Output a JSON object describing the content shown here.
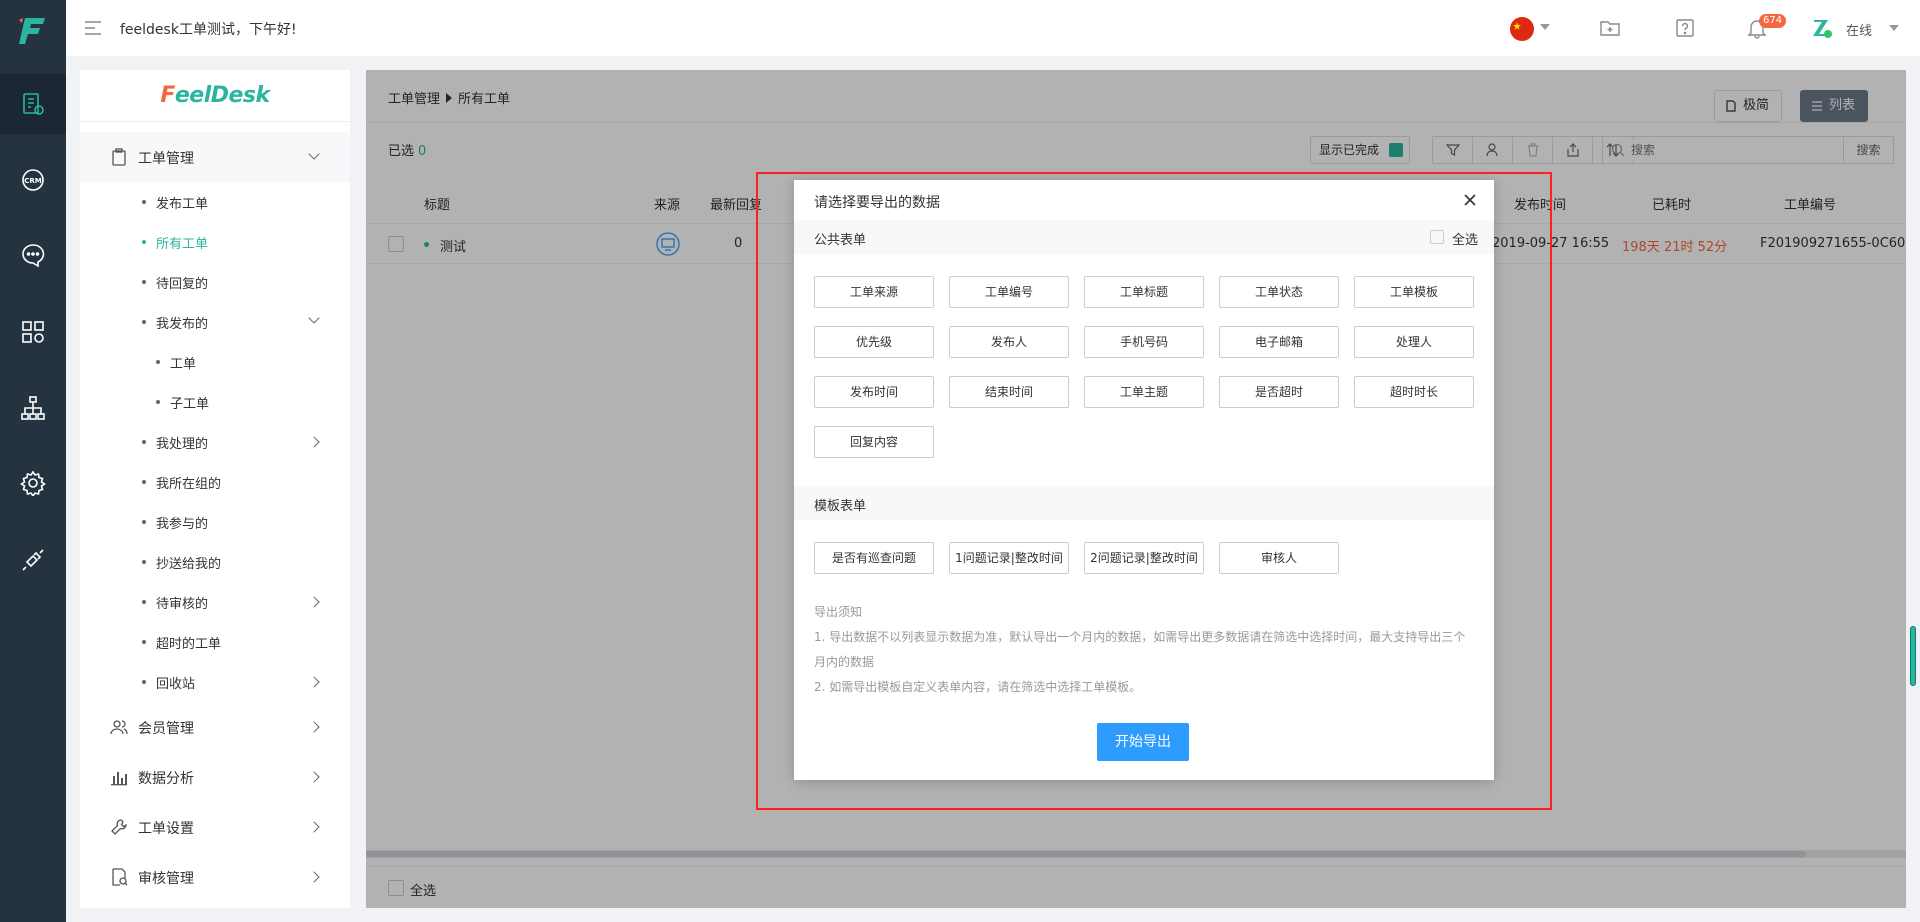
{
  "header": {
    "greeting": "feeldesk工单测试，下午好!",
    "notification_count": "674",
    "status": "在线"
  },
  "sidebar": {
    "brand": {
      "prefix": "F",
      "name": "eelDesk"
    },
    "groups": [
      {
        "label": "工单管理"
      },
      {
        "label": "会员管理"
      },
      {
        "label": "数据分析"
      },
      {
        "label": "工单设置"
      },
      {
        "label": "审核管理"
      }
    ],
    "items": [
      {
        "label": "发布工单"
      },
      {
        "label": "所有工单"
      },
      {
        "label": "待回复的"
      },
      {
        "label": "我发布的"
      },
      {
        "label": "工单"
      },
      {
        "label": "子工单"
      },
      {
        "label": "我处理的"
      },
      {
        "label": "我所在组的"
      },
      {
        "label": "我参与的"
      },
      {
        "label": "抄送给我的"
      },
      {
        "label": "待审核的"
      },
      {
        "label": "超时的工单"
      },
      {
        "label": "回收站"
      }
    ]
  },
  "main": {
    "breadcrumb": {
      "root": "工单管理",
      "current": "所有工单"
    },
    "view_simple": "极简",
    "view_list": "列表",
    "selected_label": "已选",
    "selected_count": "0",
    "show_done": "显示已完成",
    "search_placeholder": "搜索",
    "search_button": "搜索",
    "columns": {
      "title": "标题",
      "source": "来源",
      "latest_reply": "最新回复",
      "publish_time": "发布时间",
      "elapsed": "已耗时",
      "ticket_no": "工单编号"
    },
    "rows": [
      {
        "title": "测试",
        "replies": "0",
        "publish_time": "2019-09-27 16:55",
        "elapsed": "198天 21时 52分",
        "ticket_no": "F201909271655-0C60"
      }
    ],
    "footer_select_all": "全选"
  },
  "modal": {
    "title": "请选择要导出的数据",
    "public_section": "公共表单",
    "select_all": "全选",
    "public_fields": [
      "工单来源",
      "工单编号",
      "工单标题",
      "工单状态",
      "工单模板",
      "优先级",
      "发布人",
      "手机号码",
      "电子邮箱",
      "处理人",
      "发布时间",
      "结束时间",
      "工单主题",
      "是否超时",
      "超时时长",
      "回复内容"
    ],
    "template_section": "模板表单",
    "template_fields": [
      "是否有巡查问题",
      "1问题记录|整改时间",
      "2问题记录|整改时间",
      "审核人"
    ],
    "notes_title": "导出须知",
    "note1": "1. 导出数据不以列表显示数据为准，默认导出一个月内的数据，如需导出更多数据请在筛选中选择时间，最大支持导出三个月内的数据",
    "note2": "2. 如需导出模板自定义表单内容，请在筛选中选择工单模板。",
    "export_button": "开始导出"
  }
}
